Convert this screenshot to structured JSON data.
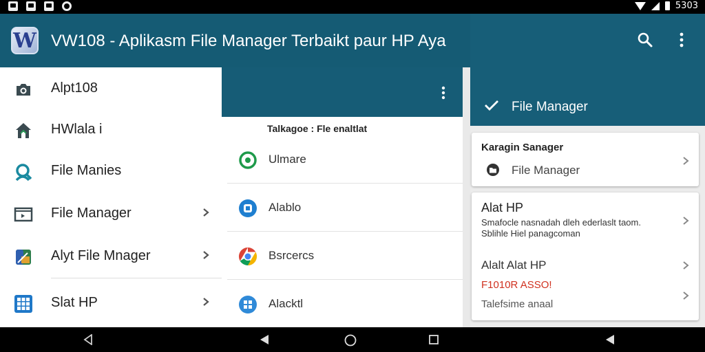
{
  "status_bar": {
    "left_icons": [
      "photo-icon",
      "notification-icon",
      "image-icon",
      "sync-icon"
    ],
    "time": "5303",
    "right_icons": [
      "wifi-icon",
      "signal-icon",
      "battery-icon"
    ]
  },
  "app_bar": {
    "logo_letter": "W",
    "title": "VW108 - Aplikasm File Manager Terbaikt paur HP Aya"
  },
  "drawer": {
    "items": [
      {
        "label": "Alpt108",
        "icon": "camera-icon",
        "chevron": false
      },
      {
        "label": "HWlala i",
        "icon": "home-icon",
        "chevron": false
      },
      {
        "label": "File Manies",
        "icon": "search-user-icon",
        "chevron": false
      },
      {
        "label": "File Manager",
        "icon": "folder-window-icon",
        "chevron": true
      },
      {
        "label": "Alyt File Mnager",
        "icon": "app-tool-icon",
        "chevron": true
      },
      {
        "label": "Slat HP",
        "icon": "grid-icon",
        "chevron": true
      }
    ]
  },
  "middle": {
    "subtitle": "Talkagoe : Fle enaltlat",
    "items": [
      {
        "label": "Ulmare",
        "icon": "green-ring-icon"
      },
      {
        "label": "Alablo",
        "icon": "blue-circle-icon"
      },
      {
        "label": "Bsrcercs",
        "icon": "chrome-icon"
      },
      {
        "label": "Alacktl",
        "icon": "blue-grid-icon"
      }
    ]
  },
  "right_panel": {
    "header_title": "File Manager",
    "card1": {
      "heading": "Karagin Sanager",
      "row_label": "File Manager"
    },
    "card2": {
      "title": "Alat HP",
      "description": "Smafocle nasnadah dleh ederlaslt taom. Sblihle Hiel panagcoman",
      "title2": "Alalt Alat HP",
      "red_label": "F1010R ASSO!",
      "sub": "Talefsime anaal"
    }
  },
  "colors": {
    "header": "#155b74",
    "accent_red": "#d0311f"
  }
}
